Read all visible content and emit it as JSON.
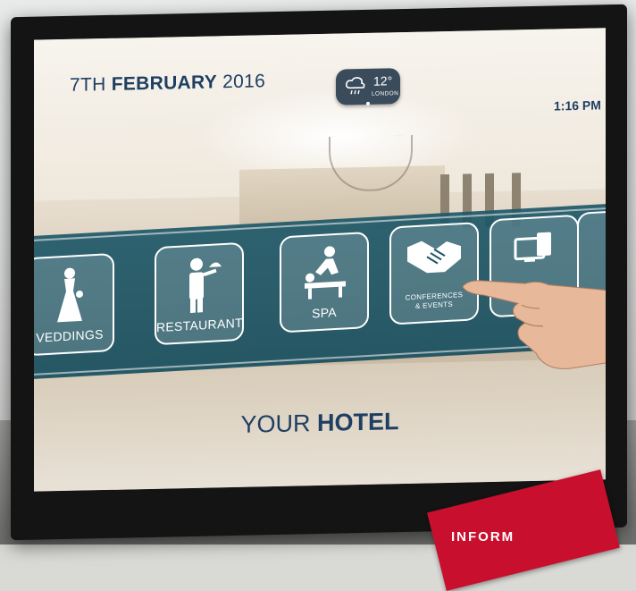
{
  "screen": {
    "date_prefix": "7TH ",
    "date_bold": "FEBRUARY",
    "date_suffix": " 2016",
    "time": "1:16 PM"
  },
  "weather": {
    "icon": "cloud-rain-icon",
    "temperature": "12°",
    "city": "LONDON"
  },
  "menu": {
    "tiles": [
      {
        "label": "VEDDINGS",
        "icon": "bride-icon"
      },
      {
        "label": "RESTAURANT",
        "icon": "waiter-icon"
      },
      {
        "label": "SPA",
        "icon": "massage-icon"
      },
      {
        "label_line1": "CONFERENCES",
        "label_line2": "& EVENTS",
        "icon": "handshake-icon"
      },
      {
        "label": "",
        "icon": "devices-icon"
      },
      {
        "label": "",
        "icon": "newspaper-icon"
      }
    ]
  },
  "footer": {
    "hotel_prefix": "YOUR ",
    "hotel_bold": "HOTEL"
  },
  "banner": {
    "text": "INFORM"
  },
  "colors": {
    "navy_text": "#1f3f62",
    "teal_band": "#1f5868",
    "bezel": "#141414",
    "banner_red": "#c8102e"
  }
}
